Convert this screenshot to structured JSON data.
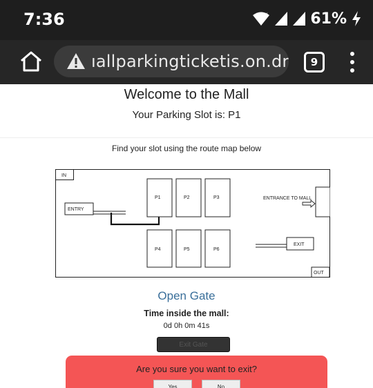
{
  "status_bar": {
    "time": "7:36",
    "battery": "61%",
    "icons": [
      "wifi-icon",
      "signal-icon",
      "signal-icon",
      "battery-charging-icon"
    ]
  },
  "browser": {
    "url": "ıallparkingticketis.on.drv.tw",
    "tab_count": "9",
    "icons": [
      "home-icon",
      "warning-icon",
      "tabs-icon",
      "more-vert-icon"
    ]
  },
  "page": {
    "title": "Welcome to the Mall",
    "slot_text": "Your Parking Slot is: P1",
    "route_heading": "Find your slot using the route map below",
    "open_gate": "Open Gate",
    "time_label": "Time inside the mall:",
    "time_value": "0d 0h 0m 41s",
    "exit_gate_label": "Exit Gate"
  },
  "map": {
    "in_label": "IN",
    "out_label": "OUT",
    "entry_label": "ENTRY",
    "exit_label": "EXIT",
    "entrance_label": "ENTRANCE TO MALL",
    "slots": [
      "P1",
      "P2",
      "P3",
      "P4",
      "P5",
      "P6"
    ]
  },
  "dialog": {
    "message": "Are you sure you want to exit?",
    "yes_label": "Yes",
    "no_label": "No",
    "color": "#f45555"
  }
}
